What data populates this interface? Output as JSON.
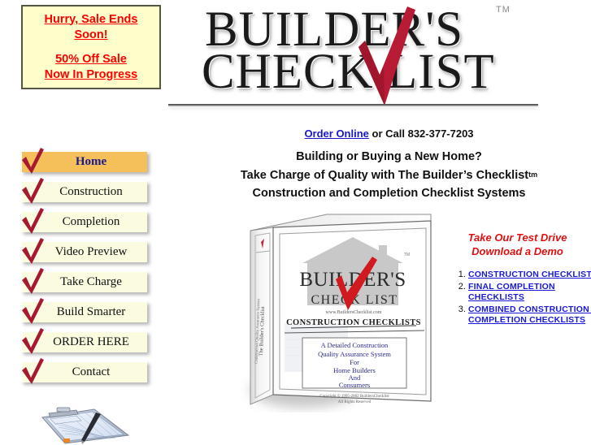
{
  "sale_box": {
    "lines_top": [
      "Hurry, Sale Ends",
      "Soon!"
    ],
    "lines_bottom": [
      "50% Off Sale",
      "Now In Progress"
    ],
    "bg_color": "#ffffcc",
    "text_color": "#ff0000",
    "border_color": "#555544"
  },
  "logo": {
    "line1": "BUILDER'S",
    "line2": "CHECK   LIST",
    "trademark": "TM",
    "check_color": "#b81b35"
  },
  "header": {
    "order_link": "Order Online",
    "order_rest": " or Call 832-377-7203",
    "tag1": "Building or Buying a New Home?",
    "tag2_pre": "Take Charge of Quality with The Builder’s Checklist",
    "tag2_tm": "tm",
    "tag3": "Construction and Completion Checklist Systems"
  },
  "nav": {
    "items": [
      {
        "label": "Home",
        "active": true
      },
      {
        "label": "Construction",
        "active": false
      },
      {
        "label": "Completion",
        "active": false
      },
      {
        "label": "Video Preview",
        "active": false
      },
      {
        "label": "Take Charge",
        "active": false
      },
      {
        "label": "Build Smarter",
        "active": false
      },
      {
        "label": "ORDER HERE",
        "active": false
      },
      {
        "label": "Contact",
        "active": false
      }
    ],
    "active_bg": "#f5c05a",
    "idle_bg": "#fbfbe0",
    "check_icon": "red-checkmark-icon"
  },
  "binder": {
    "logo_line1": "BUILDER'S",
    "logo_line2": "CHECK LIST",
    "url": "www.BuildersChecklist.com",
    "title": "CONSTRUCTION CHECKLISTS",
    "box_lines": [
      "A Detailed Construction",
      "Quality Assurance System",
      "For",
      "Home Builders",
      "And",
      "Consumers"
    ],
    "copyright": "Copyright © 1995-2002  BuildersChecklist",
    "rights": "All Rights Reserved",
    "spine_line1": "The Builder's Checklist",
    "spine_line2": "Construction Quality Assurance System",
    "trademark": "TM"
  },
  "right_col": {
    "heading_line1": "Take Our Test Drive",
    "heading_line2": "Download a Demo",
    "heading_color": "#e01010",
    "links": [
      {
        "num": "1.",
        "text": "CONSTRUCTION CHECKLISTS"
      },
      {
        "num": "2.",
        "text": "FINAL COMPLETION CHECKLISTS"
      },
      {
        "num": "3.",
        "text": "COMBINED CONSTRUCTION and COMPLETION CHECKLISTS"
      }
    ],
    "link_color": "#1818d8"
  },
  "clipboard": {
    "alt": "clipboard-with-form-and-pen"
  }
}
